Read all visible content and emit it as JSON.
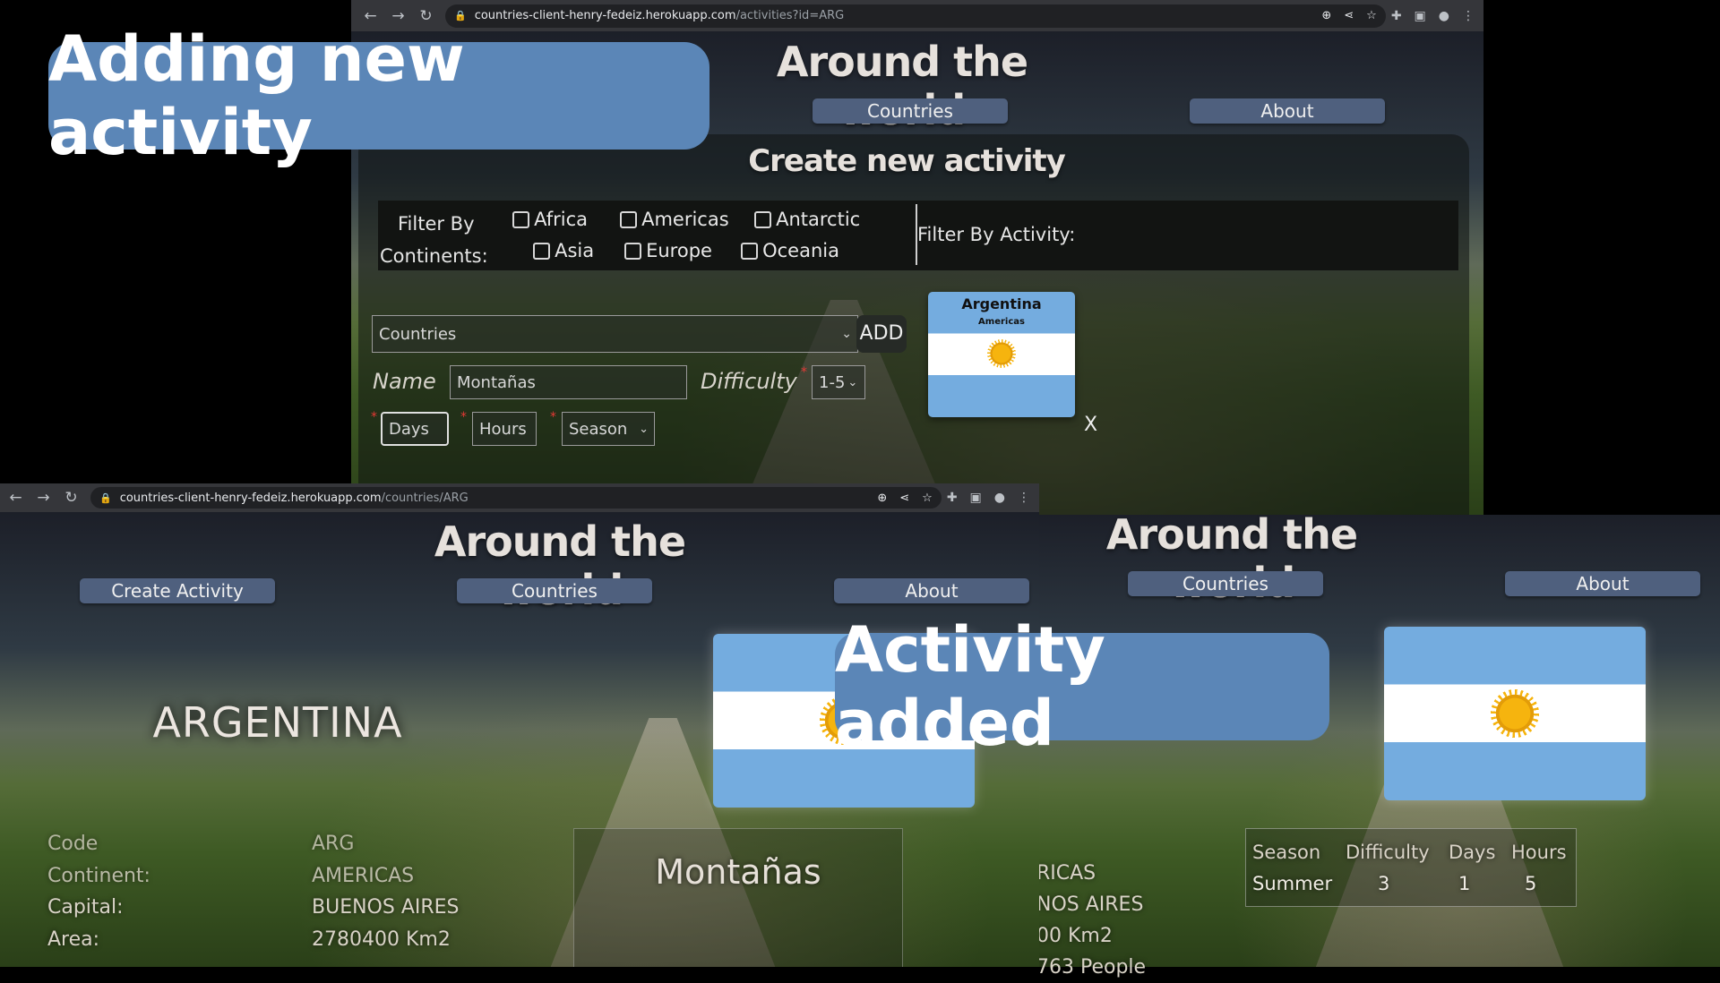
{
  "banners": {
    "adding": "Adding new activity",
    "added": "Activity added"
  },
  "browser_top": {
    "url_host": "countries-client-henry-fedeiz.herokuapp.com",
    "url_path": "/activities?id=ARG"
  },
  "browser_bottom": {
    "url_host": "countries-client-henry-fedeiz.herokuapp.com",
    "url_path": "/countries/ARG"
  },
  "app": {
    "title": "Around the world",
    "nav_countries": "Countries",
    "nav_about": "About",
    "nav_create": "Create Activity"
  },
  "create": {
    "heading": "Create new activity",
    "filter_label_1": "Filter By",
    "filter_label_2": "Continents:",
    "continents": [
      "Africa",
      "Americas",
      "Antarctic",
      "Asia",
      "Europe",
      "Oceania"
    ],
    "filter_activity": "Filter By Activity:",
    "countries_select": "Countries",
    "add_button": "ADD",
    "name_label": "Name",
    "name_value": "Montañas",
    "difficulty_label": "Difficulty",
    "difficulty_select": "1-5",
    "days_placeholder": "Days",
    "hours_placeholder": "Hours",
    "season_select": "Season",
    "required_mark": "*",
    "remove_x": "X",
    "card_country": "Argentina",
    "card_continent": "Americas"
  },
  "detail": {
    "country": "ARGENTINA",
    "rows": [
      {
        "k": "Code",
        "v": "ARG"
      },
      {
        "k": "Continent:",
        "v": "AMERICAS"
      },
      {
        "k": "Capital:",
        "v": "BUENOS AIRES"
      },
      {
        "k": "Area:",
        "v": "2780400 Km2"
      }
    ],
    "activity_name": "Montañas"
  },
  "right": {
    "partial_rows": [
      "RICAS",
      "NOS AIRES",
      "00 Km2",
      "763 People"
    ],
    "table_headers": [
      "Season",
      "Difficulty",
      "Days",
      "Hours"
    ],
    "table_row": [
      "Summer",
      "3",
      "1",
      "5"
    ]
  },
  "colors": {
    "accent": "#5b86b7",
    "navbtn": "#4f607e",
    "flag_blue": "#74acdf",
    "sun": "#f6b40e"
  }
}
